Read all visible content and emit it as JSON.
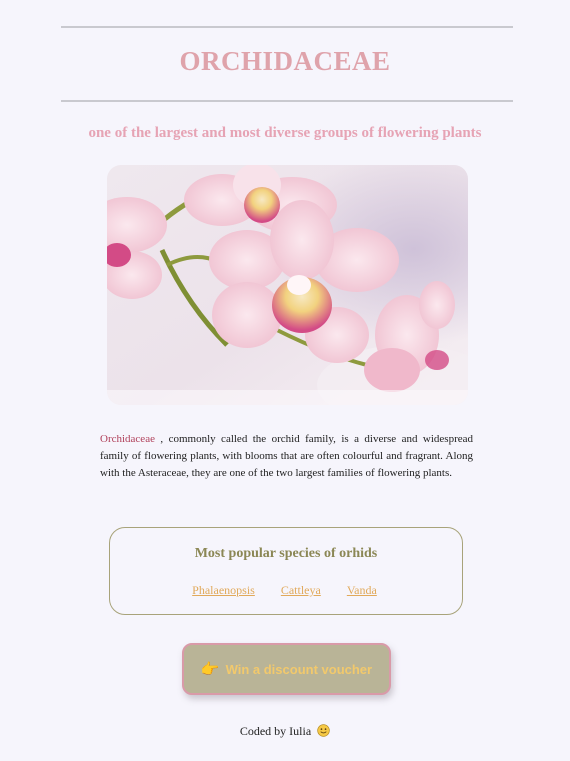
{
  "header": {
    "title": "ORCHIDACEAE",
    "subtitle": "one of the largest and most diverse groups of flowering plants"
  },
  "description": {
    "highlight": "Orchidaceae",
    "text": " , commonly called the orchid family, is a diverse and widespread family of flowering plants, with blooms that are often colourful and fragrant. Along with the Asteraceae, they are one of the two largest families of flowering plants."
  },
  "species": {
    "title": "Most popular species of orhids",
    "links": [
      "Phalaenopsis",
      "Cattleya",
      "Vanda"
    ]
  },
  "voucher": {
    "label": "Win a discount voucher",
    "icon": "pointing-hand-icon"
  },
  "footer": {
    "text": "Coded by Iulia",
    "icon": "smiley-icon"
  },
  "colors": {
    "background": "#f6f5fc",
    "title": "#dfa3ab",
    "subtitle": "#e6a3b4",
    "link": "#e1a95a",
    "species_title": "#8b8755",
    "button_bg": "#b9b497",
    "button_border": "#d99aa8",
    "button_text": "#f2c96c"
  }
}
